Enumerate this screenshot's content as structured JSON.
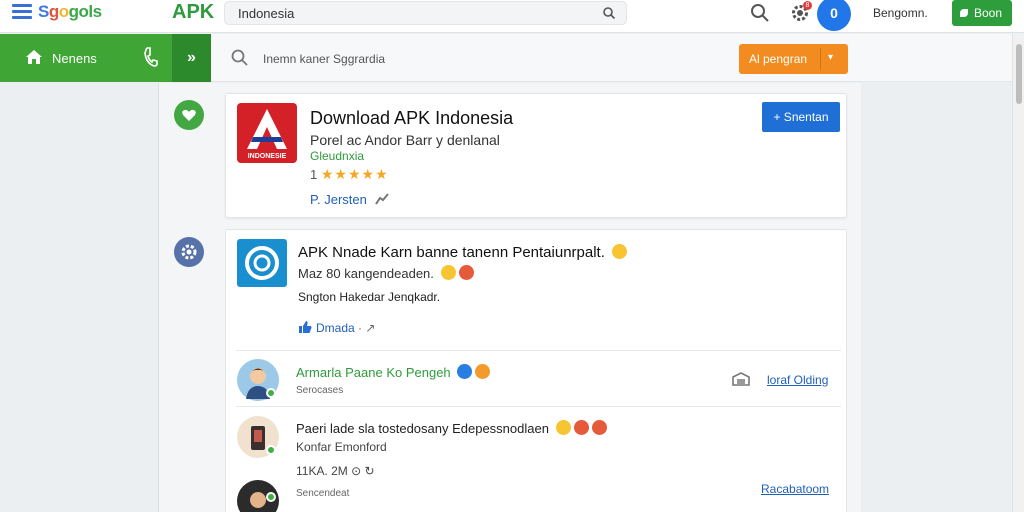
{
  "topbar": {
    "logo": [
      "S",
      "g",
      "o",
      "gols"
    ],
    "apk_label": "APK",
    "search_value": "Indonesia",
    "avatar_letter": "0",
    "notification_count": "8",
    "user_label": "Bengomn.",
    "action_button": "Boon"
  },
  "navbar": {
    "home_label": "Nenens",
    "expand_label": "»",
    "search_placeholder": "Inemn kaner Sggrardia",
    "orange_button": "Al pengran",
    "orange_caret": "▾"
  },
  "app_card": {
    "title": "Download APK Indonesia",
    "subtitle": "Porel ac Andor Barr y denlanal",
    "developer": "Gleudnxia",
    "rating_prefix": "1",
    "stars": "★★★★★",
    "link": "P. Jersten",
    "button": "+ Snentan",
    "icon_text": "INDONESIE"
  },
  "post_card": {
    "title": "APK Nnade Karn banne tanenn Pentaiunrpalt.",
    "line2": "Maz 80 kangendeaden.",
    "line3": "Sngton Hakedar Jenqkadr.",
    "like_label": "Dmada",
    "like_meta": "· ↗"
  },
  "comments": [
    {
      "name": "Armarla Paane Ko Pengeh",
      "sub": "Serocases",
      "link": "loraf Olding"
    },
    {
      "name": "Paeri lade sla tostedosany Edepessnodlaen",
      "sub": "Konfar Emonford",
      "meta": "11KA. 2M",
      "meta_icons": "⊙ ↻"
    },
    {
      "name": "",
      "sub": "Sencendeat",
      "link": "Racabatoom"
    }
  ],
  "colors": {
    "green": "#3fa535",
    "dark_green": "#2c8a2c",
    "orange": "#f28c21",
    "blue": "#1f6fd6",
    "link": "#1f5fb8",
    "star": "#f5a623"
  }
}
